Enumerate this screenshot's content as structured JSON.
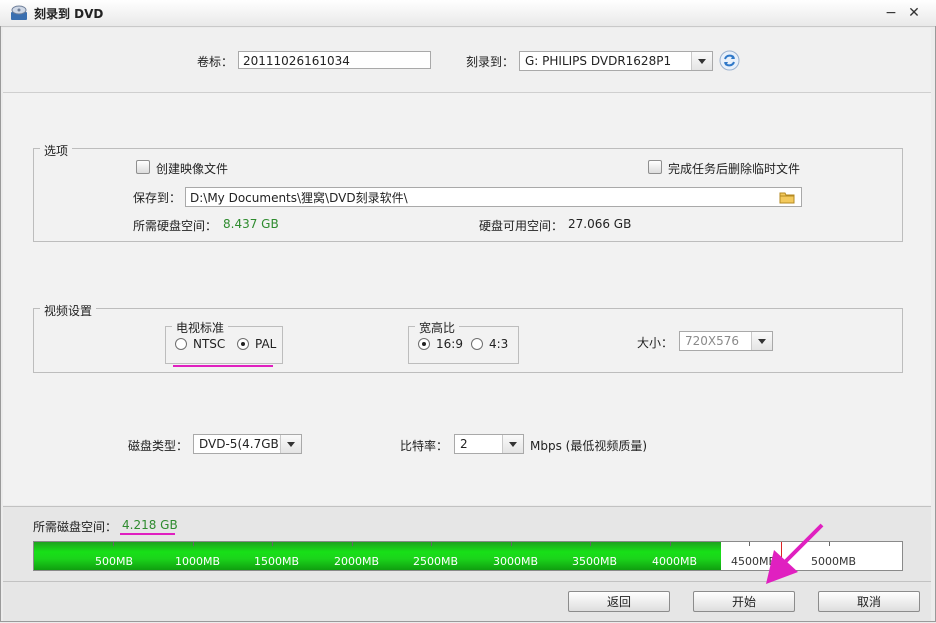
{
  "window": {
    "title": "刻录到 DVD",
    "minimize_glyph": "−",
    "close_glyph": "✕"
  },
  "top": {
    "volume_label": "卷标：",
    "volume_value": "20111026161034",
    "burn_to_label": "刻录到：",
    "drive_value": "G: PHILIPS  DVDR1628P1",
    "refresh_icon": "refresh-icon"
  },
  "options": {
    "group_title": "选项",
    "create_image_label": "创建映像文件",
    "delete_temp_label": "完成任务后删除临时文件",
    "save_to_label": "保存到：",
    "save_path": "D:\\My Documents\\狸窝\\DVD刻录软件\\",
    "folder_icon": "folder-icon",
    "required_space_label": "所需硬盘空间：",
    "required_space_value": "8.437 GB",
    "available_space_label": "硬盘可用空间：",
    "available_space_value": "27.066 GB"
  },
  "video": {
    "group_title": "视频设置",
    "tv_standard_title": "电视标准",
    "ntsc_label": "NTSC",
    "pal_label": "PAL",
    "tv_standard_selected": "PAL",
    "aspect_title": "宽高比",
    "aspect_169_label": "16:9",
    "aspect_43_label": "4:3",
    "aspect_selected": "16:9",
    "size_label": "大小：",
    "size_value": "720X576"
  },
  "disc": {
    "disc_type_label": "磁盘类型：",
    "disc_type_value": "DVD-5(4.7GB)",
    "bitrate_label": "比特率：",
    "bitrate_value": "2",
    "bitrate_unit": "Mbps (最低视频质量)"
  },
  "disk_usage": {
    "required_label": "所需磁盘空间：",
    "required_value": "4.218 GB",
    "used_mb": 4320,
    "max_mb": 5460,
    "ticks": [
      "500MB",
      "1000MB",
      "1500MB",
      "2000MB",
      "2500MB",
      "3000MB",
      "3500MB",
      "4000MB",
      "4500MB",
      "5000MB"
    ],
    "fill_color": "#17e017",
    "marker_color": "#dd2222"
  },
  "buttons": {
    "back_label": "返回",
    "start_label": "开始",
    "cancel_label": "取消"
  },
  "annotation_color": "#e020c0"
}
